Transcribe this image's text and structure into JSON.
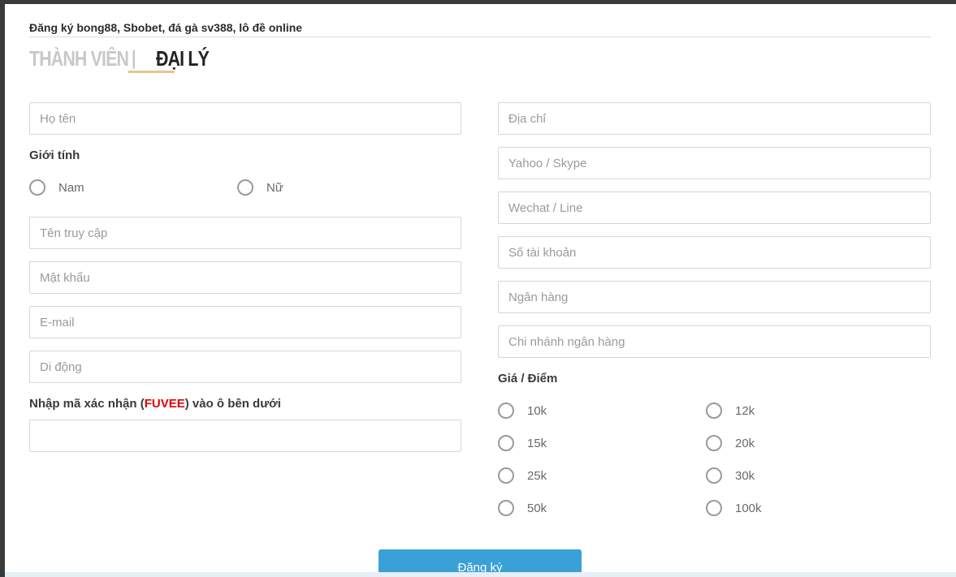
{
  "page_title": "Đăng ký bong88, Sbobet, đá gà sv388, lô đề online",
  "tabs": {
    "member": "THÀNH VIÊN",
    "separator": "|",
    "agent": "ĐẠI LÝ"
  },
  "left": {
    "fullname_placeholder": "Họ tên",
    "gender_label": "Giới tính",
    "gender_options": [
      "Nam",
      "Nữ"
    ],
    "username_placeholder": "Tên truy cập",
    "password_placeholder": "Mật khẩu",
    "email_placeholder": "E-mail",
    "phone_placeholder": "Di động",
    "captcha_label_prefix": "Nhập mã xác nhận (",
    "captcha_code": "FUVEE",
    "captcha_label_suffix": ") vào ô bên dưới",
    "captcha_value": ""
  },
  "right": {
    "address_placeholder": "Địa chỉ",
    "yahoo_placeholder": "Yahoo / Skype",
    "wechat_placeholder": "Wechat / Line",
    "account_placeholder": "Số tài khoản",
    "bank_placeholder": "Ngân hàng",
    "branch_placeholder": "Chi nhánh ngân hàng",
    "price_label": "Giá / Điểm",
    "price_options": [
      "10k",
      "12k",
      "15k",
      "20k",
      "25k",
      "30k",
      "50k",
      "100k"
    ]
  },
  "submit_label": "Đăng ký",
  "colors": {
    "accent_blue": "#3aa0d8",
    "tab_underline": "#e8c489",
    "captcha_red": "#e00000"
  }
}
